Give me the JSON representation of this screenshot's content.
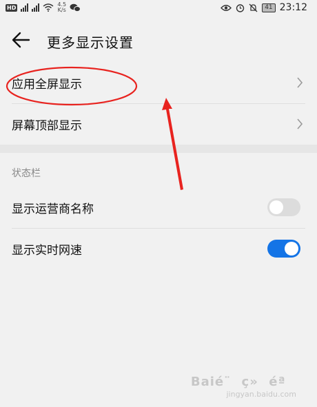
{
  "status_bar": {
    "hd_badge": "HD",
    "net1": "4G",
    "net2": "4G",
    "speed_value": "4.5",
    "speed_unit": "K/s",
    "battery": "41",
    "time": "23:12"
  },
  "header": {
    "title": "更多显示设置"
  },
  "list": {
    "items": [
      {
        "label": "应用全屏显示"
      },
      {
        "label": "屏幕顶部显示"
      }
    ]
  },
  "status_bar_section": {
    "title": "状态栏",
    "items": [
      {
        "label": "显示运营商名称",
        "enabled": false
      },
      {
        "label": "显示实时网速",
        "enabled": true
      }
    ]
  },
  "colors": {
    "toggle_on": "#1474e6",
    "toggle_off": "#dcdcdc",
    "annotation": "#e8231f"
  },
  "watermark": {
    "brand": "Baié¨ç»éª",
    "url": "jingyan.baidu.com"
  }
}
